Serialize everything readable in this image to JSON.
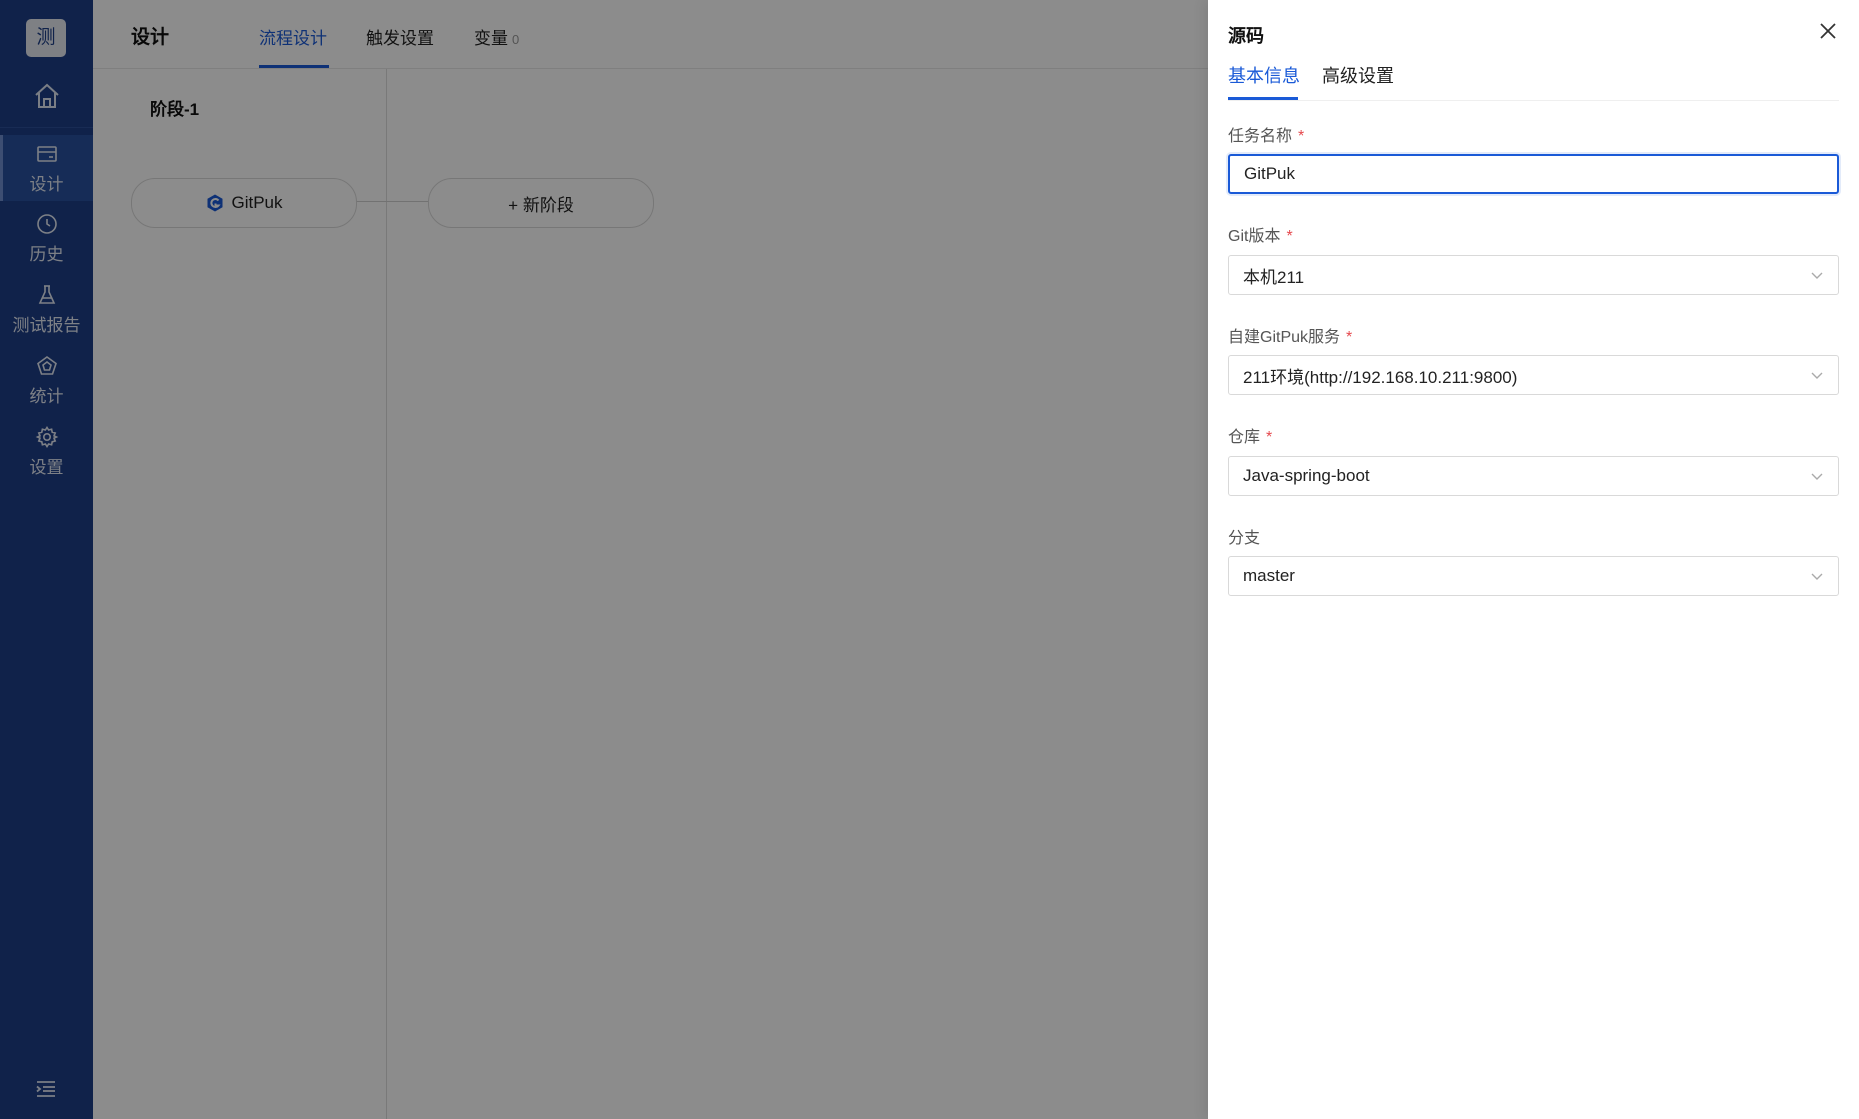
{
  "app": {
    "logo_text": "测"
  },
  "sidebar": {
    "items": [
      {
        "label": "设计",
        "icon": "card-icon",
        "active": true
      },
      {
        "label": "历史",
        "icon": "clock-icon"
      },
      {
        "label": "测试报告",
        "icon": "flask-icon"
      },
      {
        "label": "统计",
        "icon": "chart-pentagon-icon"
      },
      {
        "label": "设置",
        "icon": "gear-icon"
      }
    ]
  },
  "header": {
    "title": "设计",
    "tabs": [
      {
        "label": "流程设计",
        "active": true
      },
      {
        "label": "触发设置"
      },
      {
        "label": "变量",
        "count": "0"
      }
    ]
  },
  "canvas": {
    "stage_title": "阶段-1",
    "task_label": "GitPuk",
    "add_stage_label": "+ 新阶段"
  },
  "drawer": {
    "title": "源码",
    "tabs": [
      {
        "label": "基本信息",
        "active": true
      },
      {
        "label": "高级设置"
      }
    ],
    "fields": {
      "task_name": {
        "label": "任务名称",
        "required_mark": "*",
        "value": "GitPuk"
      },
      "git_version": {
        "label": "Git版本",
        "required_mark": "*",
        "value": "本机211"
      },
      "gitpuk_service": {
        "label": "自建GitPuk服务",
        "required_mark": "*",
        "value": "211环境(http://192.168.10.211:9800)"
      },
      "repo": {
        "label": "仓库",
        "required_mark": "*",
        "value": "Java-spring-boot"
      },
      "branch": {
        "label": "分支",
        "value": "master"
      }
    }
  },
  "colors": {
    "sidebar": "#1e3f87",
    "accent": "#1a5ad7",
    "required": "#e5484d"
  }
}
